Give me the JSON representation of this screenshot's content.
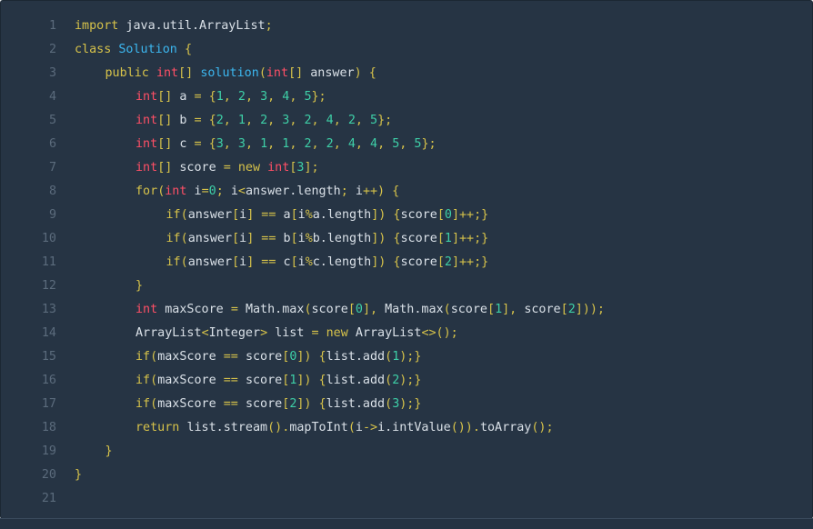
{
  "editor": {
    "language": "java",
    "colors": {
      "background": "#263444",
      "line_number": "#5b6b7c",
      "keyword": "#d6c24a",
      "type": "#ff4f66",
      "class_name": "#3cb7f0",
      "number": "#3ecfa7",
      "identifier": "#d9e0e7"
    },
    "lines": [
      {
        "n": "1",
        "indent": 0,
        "tokens": [
          [
            "kw",
            "import "
          ],
          [
            "id",
            "java.util.ArrayList"
          ],
          [
            "pun",
            ";"
          ]
        ]
      },
      {
        "n": "2",
        "indent": 0,
        "tokens": [
          [
            "kw",
            "class "
          ],
          [
            "cls",
            "Solution"
          ],
          [
            "id",
            " "
          ],
          [
            "pun",
            "{"
          ]
        ]
      },
      {
        "n": "3",
        "indent": 1,
        "tokens": [
          [
            "kw",
            "public "
          ],
          [
            "type",
            "int"
          ],
          [
            "pun",
            "[] "
          ],
          [
            "fn",
            "solution"
          ],
          [
            "pun",
            "("
          ],
          [
            "type",
            "int"
          ],
          [
            "pun",
            "[] "
          ],
          [
            "id",
            "answer"
          ],
          [
            "pun",
            ") {"
          ]
        ]
      },
      {
        "n": "4",
        "indent": 2,
        "tokens": [
          [
            "type",
            "int"
          ],
          [
            "pun",
            "[] "
          ],
          [
            "id",
            "a "
          ],
          [
            "pun",
            "= {"
          ],
          [
            "num",
            "1"
          ],
          [
            "pun",
            ", "
          ],
          [
            "num",
            "2"
          ],
          [
            "pun",
            ", "
          ],
          [
            "num",
            "3"
          ],
          [
            "pun",
            ", "
          ],
          [
            "num",
            "4"
          ],
          [
            "pun",
            ", "
          ],
          [
            "num",
            "5"
          ],
          [
            "pun",
            "};"
          ]
        ]
      },
      {
        "n": "5",
        "indent": 2,
        "tokens": [
          [
            "type",
            "int"
          ],
          [
            "pun",
            "[] "
          ],
          [
            "id",
            "b "
          ],
          [
            "pun",
            "= {"
          ],
          [
            "num",
            "2"
          ],
          [
            "pun",
            ", "
          ],
          [
            "num",
            "1"
          ],
          [
            "pun",
            ", "
          ],
          [
            "num",
            "2"
          ],
          [
            "pun",
            ", "
          ],
          [
            "num",
            "3"
          ],
          [
            "pun",
            ", "
          ],
          [
            "num",
            "2"
          ],
          [
            "pun",
            ", "
          ],
          [
            "num",
            "4"
          ],
          [
            "pun",
            ", "
          ],
          [
            "num",
            "2"
          ],
          [
            "pun",
            ", "
          ],
          [
            "num",
            "5"
          ],
          [
            "pun",
            "};"
          ]
        ]
      },
      {
        "n": "6",
        "indent": 2,
        "tokens": [
          [
            "type",
            "int"
          ],
          [
            "pun",
            "[] "
          ],
          [
            "id",
            "c "
          ],
          [
            "pun",
            "= {"
          ],
          [
            "num",
            "3"
          ],
          [
            "pun",
            ", "
          ],
          [
            "num",
            "3"
          ],
          [
            "pun",
            ", "
          ],
          [
            "num",
            "1"
          ],
          [
            "pun",
            ", "
          ],
          [
            "num",
            "1"
          ],
          [
            "pun",
            ", "
          ],
          [
            "num",
            "2"
          ],
          [
            "pun",
            ", "
          ],
          [
            "num",
            "2"
          ],
          [
            "pun",
            ", "
          ],
          [
            "num",
            "4"
          ],
          [
            "pun",
            ", "
          ],
          [
            "num",
            "4"
          ],
          [
            "pun",
            ", "
          ],
          [
            "num",
            "5"
          ],
          [
            "pun",
            ", "
          ],
          [
            "num",
            "5"
          ],
          [
            "pun",
            "};"
          ]
        ]
      },
      {
        "n": "7",
        "indent": 2,
        "tokens": [
          [
            "type",
            "int"
          ],
          [
            "pun",
            "[] "
          ],
          [
            "id",
            "score "
          ],
          [
            "pun",
            "= "
          ],
          [
            "kw",
            "new "
          ],
          [
            "type",
            "int"
          ],
          [
            "pun",
            "["
          ],
          [
            "num",
            "3"
          ],
          [
            "pun",
            "];"
          ]
        ]
      },
      {
        "n": "8",
        "indent": 2,
        "tokens": [
          [
            "kw",
            "for"
          ],
          [
            "pun",
            "("
          ],
          [
            "type",
            "int "
          ],
          [
            "id",
            "i"
          ],
          [
            "pun",
            "="
          ],
          [
            "num",
            "0"
          ],
          [
            "pun",
            "; "
          ],
          [
            "id",
            "i"
          ],
          [
            "pun",
            "<"
          ],
          [
            "id",
            "answer.length"
          ],
          [
            "pun",
            "; "
          ],
          [
            "id",
            "i"
          ],
          [
            "pun",
            "++) {"
          ]
        ]
      },
      {
        "n": "9",
        "indent": 3,
        "tokens": [
          [
            "kw",
            "if"
          ],
          [
            "pun",
            "("
          ],
          [
            "id",
            "answer"
          ],
          [
            "pun",
            "["
          ],
          [
            "id",
            "i"
          ],
          [
            "pun",
            "] == "
          ],
          [
            "id",
            "a"
          ],
          [
            "pun",
            "["
          ],
          [
            "id",
            "i"
          ],
          [
            "pun",
            "%"
          ],
          [
            "id",
            "a.length"
          ],
          [
            "pun",
            "]) {"
          ],
          [
            "id",
            "score"
          ],
          [
            "pun",
            "["
          ],
          [
            "num",
            "0"
          ],
          [
            "pun",
            "]++;}"
          ]
        ]
      },
      {
        "n": "10",
        "indent": 3,
        "tokens": [
          [
            "kw",
            "if"
          ],
          [
            "pun",
            "("
          ],
          [
            "id",
            "answer"
          ],
          [
            "pun",
            "["
          ],
          [
            "id",
            "i"
          ],
          [
            "pun",
            "] == "
          ],
          [
            "id",
            "b"
          ],
          [
            "pun",
            "["
          ],
          [
            "id",
            "i"
          ],
          [
            "pun",
            "%"
          ],
          [
            "id",
            "b.length"
          ],
          [
            "pun",
            "]) {"
          ],
          [
            "id",
            "score"
          ],
          [
            "pun",
            "["
          ],
          [
            "num",
            "1"
          ],
          [
            "pun",
            "]++;}"
          ]
        ]
      },
      {
        "n": "11",
        "indent": 3,
        "tokens": [
          [
            "kw",
            "if"
          ],
          [
            "pun",
            "("
          ],
          [
            "id",
            "answer"
          ],
          [
            "pun",
            "["
          ],
          [
            "id",
            "i"
          ],
          [
            "pun",
            "] == "
          ],
          [
            "id",
            "c"
          ],
          [
            "pun",
            "["
          ],
          [
            "id",
            "i"
          ],
          [
            "pun",
            "%"
          ],
          [
            "id",
            "c.length"
          ],
          [
            "pun",
            "]) {"
          ],
          [
            "id",
            "score"
          ],
          [
            "pun",
            "["
          ],
          [
            "num",
            "2"
          ],
          [
            "pun",
            "]++;}"
          ]
        ]
      },
      {
        "n": "12",
        "indent": 2,
        "tokens": [
          [
            "pun",
            "}"
          ]
        ]
      },
      {
        "n": "13",
        "indent": 2,
        "tokens": [
          [
            "type",
            "int "
          ],
          [
            "id",
            "maxScore "
          ],
          [
            "pun",
            "= "
          ],
          [
            "id",
            "Math.max"
          ],
          [
            "pun",
            "("
          ],
          [
            "id",
            "score"
          ],
          [
            "pun",
            "["
          ],
          [
            "num",
            "0"
          ],
          [
            "pun",
            "], "
          ],
          [
            "id",
            "Math.max"
          ],
          [
            "pun",
            "("
          ],
          [
            "id",
            "score"
          ],
          [
            "pun",
            "["
          ],
          [
            "num",
            "1"
          ],
          [
            "pun",
            "], "
          ],
          [
            "id",
            "score"
          ],
          [
            "pun",
            "["
          ],
          [
            "num",
            "2"
          ],
          [
            "pun",
            "]));"
          ]
        ]
      },
      {
        "n": "14",
        "indent": 2,
        "tokens": [
          [
            "id",
            "ArrayList"
          ],
          [
            "pun",
            "<"
          ],
          [
            "id",
            "Integer"
          ],
          [
            "pun",
            "> "
          ],
          [
            "id",
            "list "
          ],
          [
            "pun",
            "= "
          ],
          [
            "kw",
            "new "
          ],
          [
            "id",
            "ArrayList"
          ],
          [
            "pun",
            "<>();"
          ]
        ]
      },
      {
        "n": "15",
        "indent": 2,
        "tokens": [
          [
            "kw",
            "if"
          ],
          [
            "pun",
            "("
          ],
          [
            "id",
            "maxScore "
          ],
          [
            "pun",
            "== "
          ],
          [
            "id",
            "score"
          ],
          [
            "pun",
            "["
          ],
          [
            "num",
            "0"
          ],
          [
            "pun",
            "]) {"
          ],
          [
            "id",
            "list.add"
          ],
          [
            "pun",
            "("
          ],
          [
            "num",
            "1"
          ],
          [
            "pun",
            ");}"
          ]
        ]
      },
      {
        "n": "16",
        "indent": 2,
        "tokens": [
          [
            "kw",
            "if"
          ],
          [
            "pun",
            "("
          ],
          [
            "id",
            "maxScore "
          ],
          [
            "pun",
            "== "
          ],
          [
            "id",
            "score"
          ],
          [
            "pun",
            "["
          ],
          [
            "num",
            "1"
          ],
          [
            "pun",
            "]) {"
          ],
          [
            "id",
            "list.add"
          ],
          [
            "pun",
            "("
          ],
          [
            "num",
            "2"
          ],
          [
            "pun",
            ");}"
          ]
        ]
      },
      {
        "n": "17",
        "indent": 2,
        "tokens": [
          [
            "kw",
            "if"
          ],
          [
            "pun",
            "("
          ],
          [
            "id",
            "maxScore "
          ],
          [
            "pun",
            "== "
          ],
          [
            "id",
            "score"
          ],
          [
            "pun",
            "["
          ],
          [
            "num",
            "2"
          ],
          [
            "pun",
            "]) {"
          ],
          [
            "id",
            "list.add"
          ],
          [
            "pun",
            "("
          ],
          [
            "num",
            "3"
          ],
          [
            "pun",
            ");}"
          ]
        ]
      },
      {
        "n": "18",
        "indent": 2,
        "tokens": [
          [
            "kw",
            "return "
          ],
          [
            "id",
            "list.stream"
          ],
          [
            "pun",
            "()."
          ],
          [
            "id",
            "mapToInt"
          ],
          [
            "pun",
            "("
          ],
          [
            "id",
            "i"
          ],
          [
            "pun",
            "->"
          ],
          [
            "id",
            "i.intValue"
          ],
          [
            "pun",
            "())."
          ],
          [
            "id",
            "toArray"
          ],
          [
            "pun",
            "();"
          ]
        ]
      },
      {
        "n": "19",
        "indent": 1,
        "tokens": [
          [
            "pun",
            "}"
          ]
        ]
      },
      {
        "n": "20",
        "indent": 0,
        "tokens": [
          [
            "pun",
            "}"
          ]
        ]
      },
      {
        "n": "21",
        "indent": 0,
        "tokens": []
      }
    ]
  }
}
